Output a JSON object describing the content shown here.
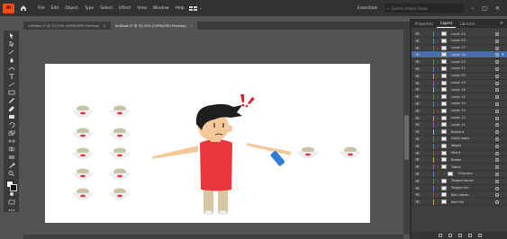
{
  "app": {
    "logo": "Ai",
    "accent": "#ff4b12"
  },
  "menu": [
    "File",
    "Edit",
    "Object",
    "Type",
    "Select",
    "Effect",
    "View",
    "Window",
    "Help"
  ],
  "workspace": {
    "label": "Essentials",
    "search_placeholder": "Search Adobe Stock"
  },
  "tabs": [
    {
      "label": "Untitled-1* @ 33,33% (CMYK/GPU Preview)",
      "active": false
    },
    {
      "label": "Untitled-2* @ 33,33% (CMYK/GPU Preview)",
      "active": true
    }
  ],
  "panel": {
    "tabs": [
      "Properties",
      "Layers",
      "Libraries"
    ],
    "active_tab": "Layers",
    "layers": [
      {
        "name": "Layer 24",
        "color": "#4f7fff",
        "selected": false,
        "sub": false
      },
      {
        "name": "Layer 23",
        "color": "#4f7fff",
        "selected": false,
        "sub": false
      },
      {
        "name": "Layer 17",
        "color": "#e03a3a",
        "selected": false,
        "sub": false
      },
      {
        "name": "Layer 16",
        "color": "#e03a3a",
        "selected": true,
        "sub": false
      },
      {
        "name": "Layer 22",
        "color": "#1fb34e",
        "selected": false,
        "sub": false
      },
      {
        "name": "Layer 21",
        "color": "#4f7fff",
        "selected": false,
        "sub": false
      },
      {
        "name": "Layer 20",
        "color": "#d8a23a",
        "selected": false,
        "sub": false
      },
      {
        "name": "Layer 19",
        "color": "#b04fd8",
        "selected": false,
        "sub": false
      },
      {
        "name": "Layer 18",
        "color": "#4fd8d8",
        "selected": false,
        "sub": false
      },
      {
        "name": "Layer 15",
        "color": "#1fb34e",
        "selected": false,
        "sub": false
      },
      {
        "name": "Layer 14",
        "color": "#4f7fff",
        "selected": false,
        "sub": false
      },
      {
        "name": "Layer 13",
        "color": "#e03a3a",
        "selected": false,
        "sub": false
      },
      {
        "name": "Layer 12",
        "color": "#d8a23a",
        "selected": false,
        "sub": false
      },
      {
        "name": "Layer 11",
        "color": "#b04fd8",
        "selected": false,
        "sub": false
      },
      {
        "name": "Rambut",
        "color": "#4fd8d8",
        "selected": false,
        "sub": false
      },
      {
        "name": "Garis mata",
        "color": "#1fb34e",
        "selected": false,
        "sub": false
      },
      {
        "name": "Wajah",
        "color": "#4f7fff",
        "selected": false,
        "sub": false
      },
      {
        "name": "Mulut",
        "color": "#e03a3a",
        "selected": false,
        "sub": false
      },
      {
        "name": "Badan",
        "color": "#d8a23a",
        "selected": false,
        "sub": false
      },
      {
        "name": "Tubuh",
        "color": "#b04fd8",
        "selected": false,
        "sub": false
      },
      {
        "name": "<Group>",
        "color": "#4f7fff",
        "selected": false,
        "sub": true
      },
      {
        "name": "Tangan kanan",
        "color": "#1fb34e",
        "selected": false,
        "sub": false
      },
      {
        "name": "Tangan kiri",
        "color": "#4f7fff",
        "selected": false,
        "sub": false
      },
      {
        "name": "Kaki kanan",
        "color": "#e03a3a",
        "selected": false,
        "sub": false
      },
      {
        "name": "Kaki kiri",
        "color": "#d8a23a",
        "selected": false,
        "sub": false
      }
    ]
  },
  "artwork": {
    "shirt_color": "#e8363c",
    "skin_color": "#f5c89a",
    "pants_color": "#d6c7a5",
    "hair_color": "#1e1e1e",
    "phone_color": "#2f7bd6",
    "exclaim_color": "#e21f26",
    "rice_bowls": 12
  }
}
